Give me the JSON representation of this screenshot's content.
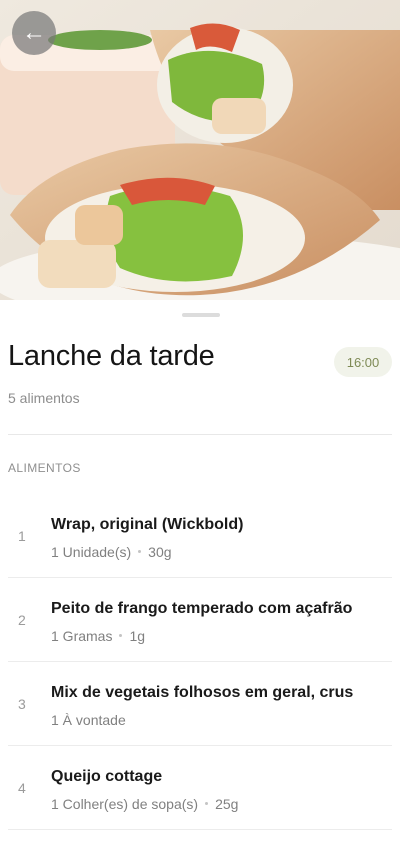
{
  "header": {
    "back_icon": "arrow-left-icon",
    "back_glyph": "←"
  },
  "meal": {
    "title": "Lanche da tarde",
    "time": "16:00",
    "food_count": "5 alimentos"
  },
  "section_label": "ALIMENTOS",
  "foods": [
    {
      "index": "1",
      "name": "Wrap, original (Wickbold)",
      "quantity": "1 Unidade(s)",
      "weight": "30g"
    },
    {
      "index": "2",
      "name": "Peito de frango temperado com açafrão",
      "quantity": "1 Gramas",
      "weight": "1g"
    },
    {
      "index": "3",
      "name": "Mix de vegetais folhosos em geral, crus",
      "quantity": "1 À vontade",
      "weight": ""
    },
    {
      "index": "4",
      "name": "Queijo cottage",
      "quantity": "1 Colher(es) de sopa(s)",
      "weight": "25g"
    }
  ],
  "colors": {
    "accent_text": "#7e8a55",
    "badge_bg": "#f1f3ea"
  }
}
